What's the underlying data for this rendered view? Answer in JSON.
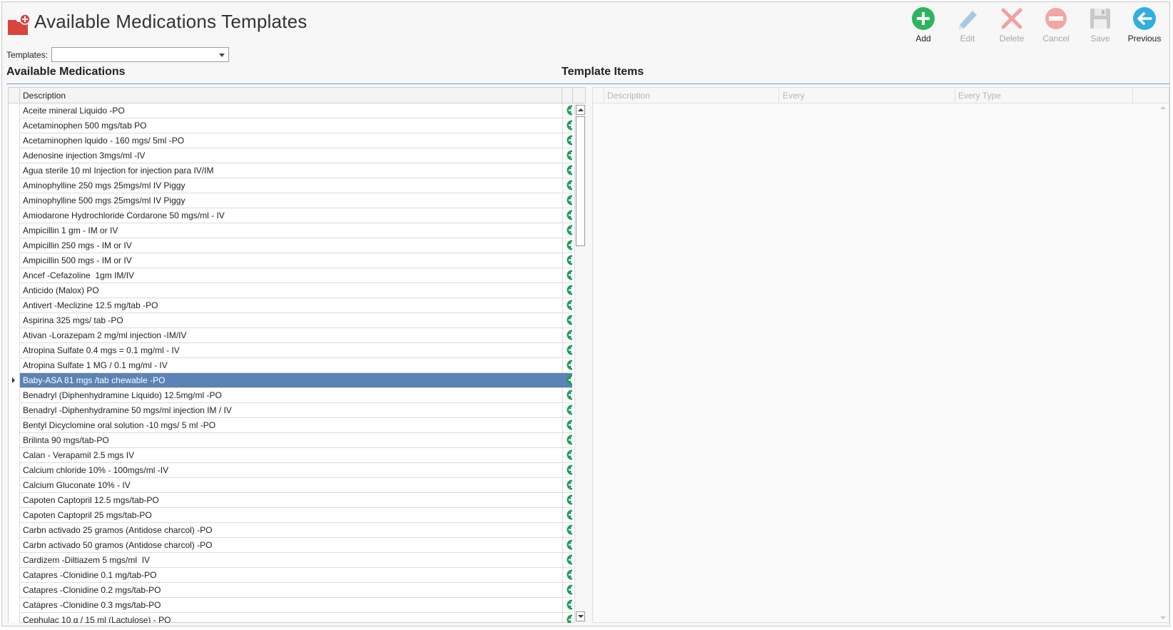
{
  "header": {
    "title": "Available Medications Templates",
    "icon": "medical-folder-icon"
  },
  "toolbar": {
    "add": "Add",
    "edit": "Edit",
    "delete": "Delete",
    "cancel": "Cancel",
    "save": "Save",
    "previous": "Previous"
  },
  "templates": {
    "label": "Templates:",
    "value": ""
  },
  "available": {
    "title": "Available Medications",
    "column": "Description",
    "selected_index": 18,
    "items": [
      "Aceite mineral Liquido -PO",
      "Acetaminophen 500 mgs/tab PO",
      "Acetaminophen lquido - 160 mgs/ 5ml -PO",
      "Adenosine injection 3mgs/ml -IV",
      "Agua sterile 10 ml Injection for injection para IV/IM",
      "Aminophylline 250 mgs 25mgs/ml IV Piggy",
      "Aminophylline 500 mgs 25mgs/ml IV Piggy",
      "Amiodarone Hydrochloride Cordarone 50 mgs/ml - IV",
      "Ampicillin 1 gm - IM or IV",
      "Ampicillin 250 mgs - IM or IV",
      "Ampicillin 500 mgs - IM or IV",
      "Ancef -Cefazoline  1gm IM/IV",
      "Anticido (Malox) PO",
      "Antivert -Meclizine 12.5 mg/tab -PO",
      "Aspirina 325 mgs/ tab -PO",
      "Ativan -Lorazepam 2 mg/ml injection -IM/IV",
      "Atropina Sulfate 0.4 mgs = 0.1 mg/ml - IV",
      "Atropina Sulfate 1 MG / 0.1 mg/ml - IV",
      "Baby-ASA 81 mgs /tab chewable -PO",
      "Benadryl (Diphenhydramine Liquido) 12.5mg/ml -PO",
      "Benadryl -Diphenhydramine 50 mgs/ml injection IM / IV",
      "Bentyl Dicyclomine oral solution -10 mgs/ 5 ml -PO",
      "Brilinta 90 mgs/tab-PO",
      "Calan - Verapamil 2.5 mgs IV",
      "Calcium chloride 10% - 100mgs/ml -IV",
      "Calcium Gluconate 10% - IV",
      "Capoten Captopril 12.5 mgs/tab-PO",
      "Capoten Captopril 25 mgs/tab-PO",
      "Carbn activado 25 gramos (Antidose charcol) -PO",
      "Carbn activado 50 gramos (Antidose charcol) -PO",
      "Cardizem -Diltiazem 5 mgs/ml  IV",
      "Catapres -Clonidine 0.1 mg/tab-PO",
      "Catapres -Clonidine 0.2 mgs/tab-PO",
      "Catapres -Clonidine 0.3 mgs/tab-PO",
      "Cephulac 10 g / 15 ml (Lactulose) - PO"
    ]
  },
  "template_items": {
    "title": "Template Items",
    "columns": [
      "Description",
      "Every",
      "Every Type"
    ]
  },
  "colors": {
    "add_green": "#1e9e5a",
    "selection": "#5b83b5",
    "delete_red": "#f07f7f",
    "disabled_gray": "#a6a6a6",
    "previous_teal": "#2aa3c9",
    "section_line": "#6f9fcf"
  }
}
